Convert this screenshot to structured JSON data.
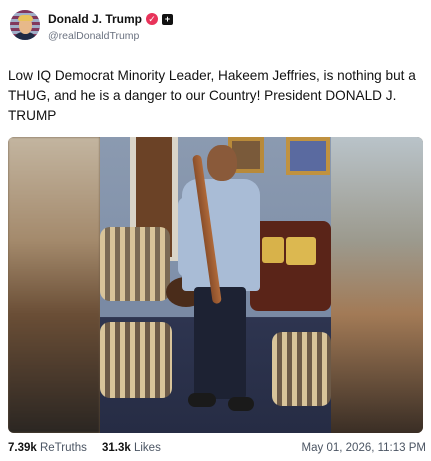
{
  "author": {
    "display_name": "Donald J. Trump",
    "handle": "@realDonaldTrump",
    "verified_icon": "verified-badge-icon",
    "affiliation_icon": "square-plus-badge-icon"
  },
  "post": {
    "text": "Low IQ Democrat Minority Leader, Hakeem Jeffries, is nothing but a THUG, and he is a danger to our Country! President DONALD J. TRUMP",
    "media": {
      "description_icon": "photo-icon"
    }
  },
  "stats": {
    "retruths_count": "7.39k",
    "retruths_label": "ReTruths",
    "likes_count": "31.3k",
    "likes_label": "Likes",
    "timestamp": "May 01, 2026, 11:13 PM"
  },
  "colors": {
    "verified": "#e8335a",
    "muted_text": "#6b7280"
  }
}
